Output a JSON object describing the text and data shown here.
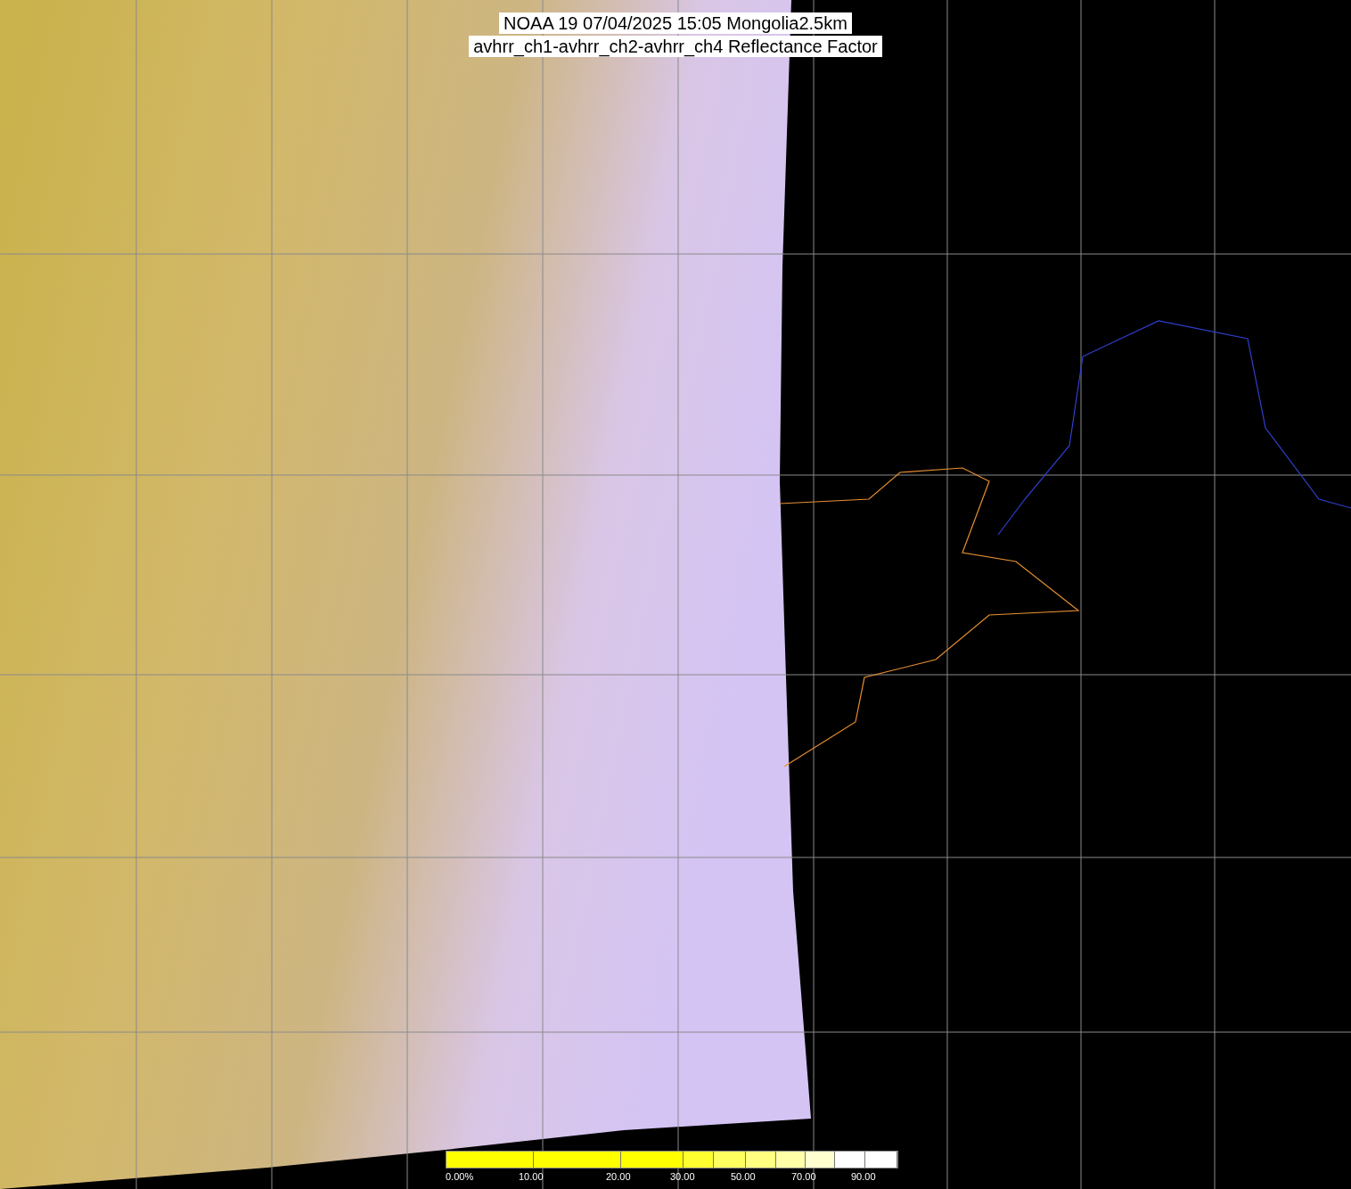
{
  "title_lines": [
    "NOAA 19 07/04/2025 15:05 Mongolia2.5km",
    "avhrr_ch1-avhrr_ch2-avhrr_ch4 Reflectance Factor"
  ],
  "colorbar": {
    "segments": [
      {
        "color": "#ffff00"
      },
      {
        "color": "#ffff00"
      },
      {
        "color": "#ffff00"
      },
      {
        "color": "#ffff30"
      },
      {
        "color": "#ffff60"
      },
      {
        "color": "#ffff80"
      },
      {
        "color": "#ffffa8"
      },
      {
        "color": "#ffffd0"
      },
      {
        "color": "#ffffff"
      },
      {
        "color": "#ffffff"
      }
    ],
    "labels": [
      "0.00%",
      "10.00",
      "20.00",
      "30.00",
      "50.00",
      "70.00",
      "90.00"
    ]
  }
}
